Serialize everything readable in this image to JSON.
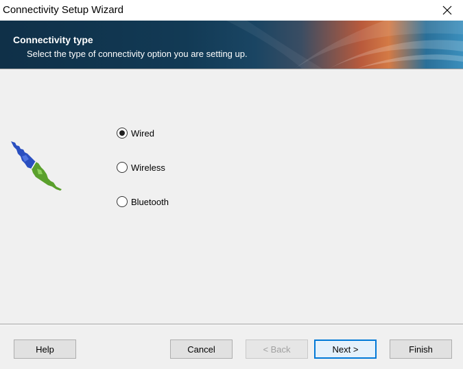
{
  "window": {
    "title": "Connectivity Setup Wizard"
  },
  "header": {
    "title": "Connectivity type",
    "subtitle": "Select the type of connectivity option you are setting up."
  },
  "options": [
    {
      "label": "Wired",
      "selected": true
    },
    {
      "label": "Wireless",
      "selected": false
    },
    {
      "label": "Bluetooth",
      "selected": false
    }
  ],
  "buttons": {
    "help": "Help",
    "cancel": "Cancel",
    "back": "< Back",
    "next": "Next >",
    "finish": "Finish"
  },
  "icons": {
    "close": "close-icon",
    "graphic": "network-plug-icon"
  },
  "colors": {
    "accent": "#0078d7",
    "plug_blue": "#2a4fc0",
    "plug_green": "#5aa02c"
  }
}
